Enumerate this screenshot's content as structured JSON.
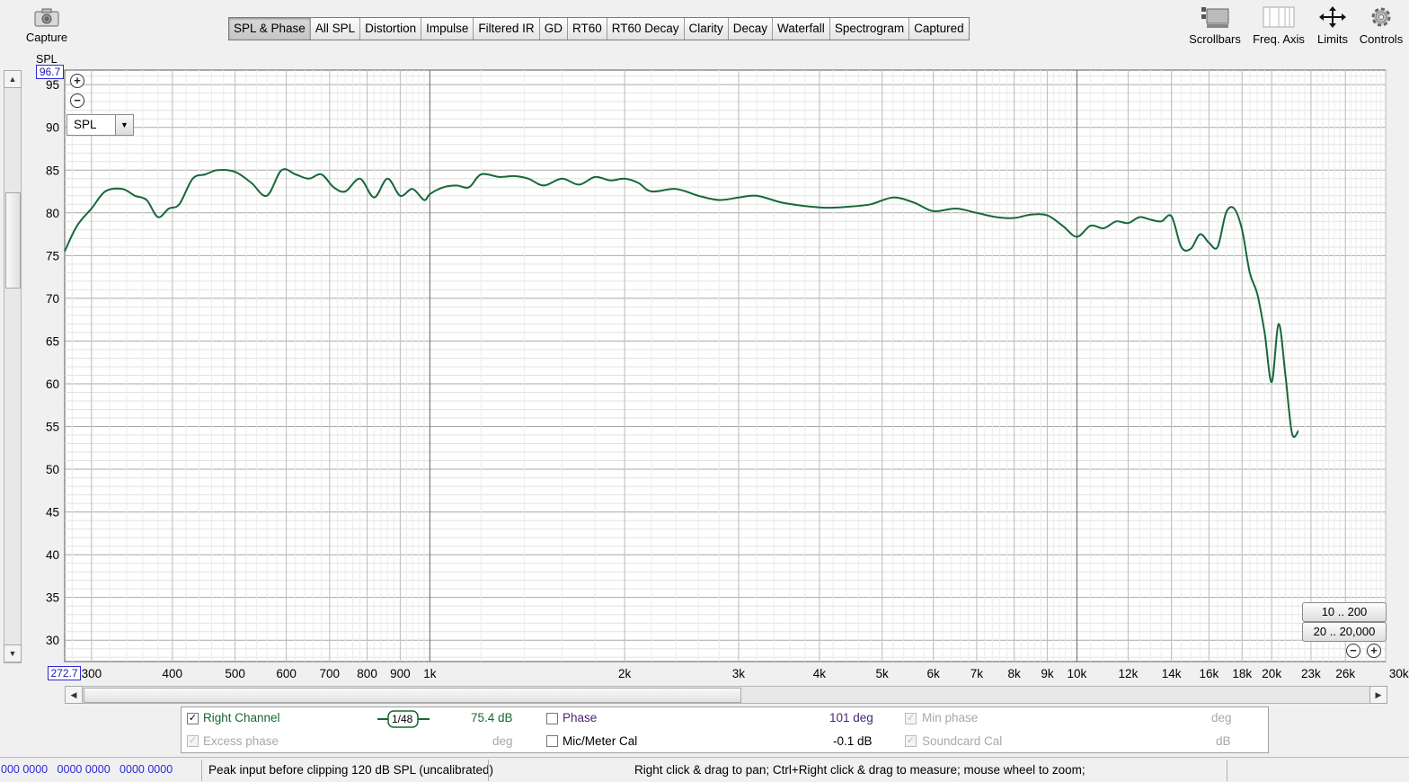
{
  "toolbar": {
    "capture_label": "Capture",
    "scrollbars_label": "Scrollbars",
    "freq_axis_label": "Freq. Axis",
    "limits_label": "Limits",
    "controls_label": "Controls",
    "tabs": [
      "SPL & Phase",
      "All SPL",
      "Distortion",
      "Impulse",
      "Filtered IR",
      "GD",
      "RT60",
      "RT60 Decay",
      "Clarity",
      "Decay",
      "Waterfall",
      "Spectrogram",
      "Captured"
    ],
    "active_tab": "SPL & Phase"
  },
  "plot": {
    "y_unit": "SPL",
    "y_top_readout": "96.7",
    "x_left_readout": "272.7",
    "selector_value": "SPL",
    "range_buttons": [
      "10 .. 200",
      "20 .. 20,000"
    ],
    "line_color": "#16683a"
  },
  "chart_data": {
    "type": "line",
    "xscale": "log",
    "xlim": [
      272.7,
      30000
    ],
    "ylim": [
      27.5,
      96.7
    ],
    "ylabel": "SPL",
    "grid": true,
    "yticks": [
      95,
      90,
      85,
      80,
      75,
      70,
      65,
      60,
      55,
      50,
      45,
      40,
      35,
      30
    ],
    "xticks": [
      {
        "v": 300,
        "label": "300"
      },
      {
        "v": 400,
        "label": "400"
      },
      {
        "v": 500,
        "label": "500"
      },
      {
        "v": 600,
        "label": "600"
      },
      {
        "v": 700,
        "label": "700"
      },
      {
        "v": 800,
        "label": "800"
      },
      {
        "v": 900,
        "label": "900"
      },
      {
        "v": 1000,
        "label": "1k"
      },
      {
        "v": 2000,
        "label": "2k"
      },
      {
        "v": 3000,
        "label": "3k"
      },
      {
        "v": 4000,
        "label": "4k"
      },
      {
        "v": 5000,
        "label": "5k"
      },
      {
        "v": 6000,
        "label": "6k"
      },
      {
        "v": 7000,
        "label": "7k"
      },
      {
        "v": 8000,
        "label": "8k"
      },
      {
        "v": 9000,
        "label": "9k"
      },
      {
        "v": 10000,
        "label": "10k"
      },
      {
        "v": 12000,
        "label": "12k"
      },
      {
        "v": 14000,
        "label": "14k"
      },
      {
        "v": 16000,
        "label": "16k"
      },
      {
        "v": 18000,
        "label": "18k"
      },
      {
        "v": 20000,
        "label": "20k"
      },
      {
        "v": 23000,
        "label": "23k"
      },
      {
        "v": 26000,
        "label": "26k"
      },
      {
        "v": 30000,
        "label": "30kHz"
      }
    ],
    "series": [
      {
        "name": "Right Channel",
        "x": [
          272.7,
          285,
          300,
          315,
          335,
          350,
          365,
          380,
          395,
          410,
          430,
          450,
          470,
          500,
          530,
          560,
          590,
          620,
          650,
          680,
          710,
          740,
          780,
          820,
          860,
          900,
          940,
          980,
          1000,
          1050,
          1100,
          1150,
          1200,
          1280,
          1350,
          1420,
          1500,
          1600,
          1700,
          1800,
          1900,
          2000,
          2100,
          2200,
          2400,
          2600,
          2800,
          3000,
          3200,
          3500,
          3800,
          4100,
          4400,
          4800,
          5200,
          5600,
          6000,
          6500,
          7000,
          7500,
          8000,
          8500,
          9000,
          9500,
          10000,
          10500,
          11000,
          11500,
          12000,
          12500,
          13000,
          13500,
          14000,
          14500,
          15000,
          15500,
          16000,
          16500,
          17000,
          17500,
          18000,
          18500,
          19000,
          19500,
          20000,
          20500,
          21000,
          21500,
          22000
        ],
        "y": [
          75.5,
          78.5,
          80.5,
          82.5,
          82.8,
          82.0,
          81.5,
          79.5,
          80.5,
          81.0,
          84.0,
          84.5,
          85.0,
          84.8,
          83.5,
          82.0,
          85.0,
          84.5,
          84.0,
          84.5,
          83.0,
          82.5,
          84.0,
          81.8,
          84.0,
          82.0,
          82.8,
          81.5,
          82.2,
          83.0,
          83.2,
          83.0,
          84.5,
          84.2,
          84.3,
          84.0,
          83.2,
          84.0,
          83.3,
          84.2,
          83.8,
          84.0,
          83.5,
          82.5,
          82.8,
          82.0,
          81.5,
          81.8,
          82.0,
          81.2,
          80.8,
          80.6,
          80.7,
          81.0,
          81.8,
          81.2,
          80.2,
          80.5,
          80.0,
          79.5,
          79.4,
          79.8,
          79.7,
          78.5,
          77.2,
          78.5,
          78.2,
          79.0,
          78.8,
          79.5,
          79.2,
          79.0,
          79.6,
          76.0,
          75.8,
          77.5,
          76.5,
          76.0,
          80.0,
          80.5,
          78.0,
          73.0,
          70.5,
          66.0,
          60.2,
          67.0,
          61.0,
          54.2,
          54.5
        ]
      }
    ]
  },
  "legend": {
    "right_channel_label": "Right Channel",
    "right_channel_value": "75.4 dB",
    "smoothing_label": "1/48",
    "excess_phase_label": "Excess phase",
    "excess_phase_unit": "deg",
    "phase_label": "Phase",
    "phase_value": "101 deg",
    "mic_cal_label": "Mic/Meter Cal",
    "mic_cal_value": "-0.1 dB",
    "min_phase_label": "Min phase",
    "min_phase_unit": "deg",
    "soundcard_cal_label": "Soundcard Cal",
    "soundcard_cal_unit": "dB"
  },
  "status": {
    "levels": "000 0000   0000 0000   0000 0000",
    "peak": "Peak input before clipping 120 dB SPL (uncalibrated)",
    "hint": "Right click & drag to pan; Ctrl+Right click & drag to measure; mouse wheel to zoom;"
  }
}
